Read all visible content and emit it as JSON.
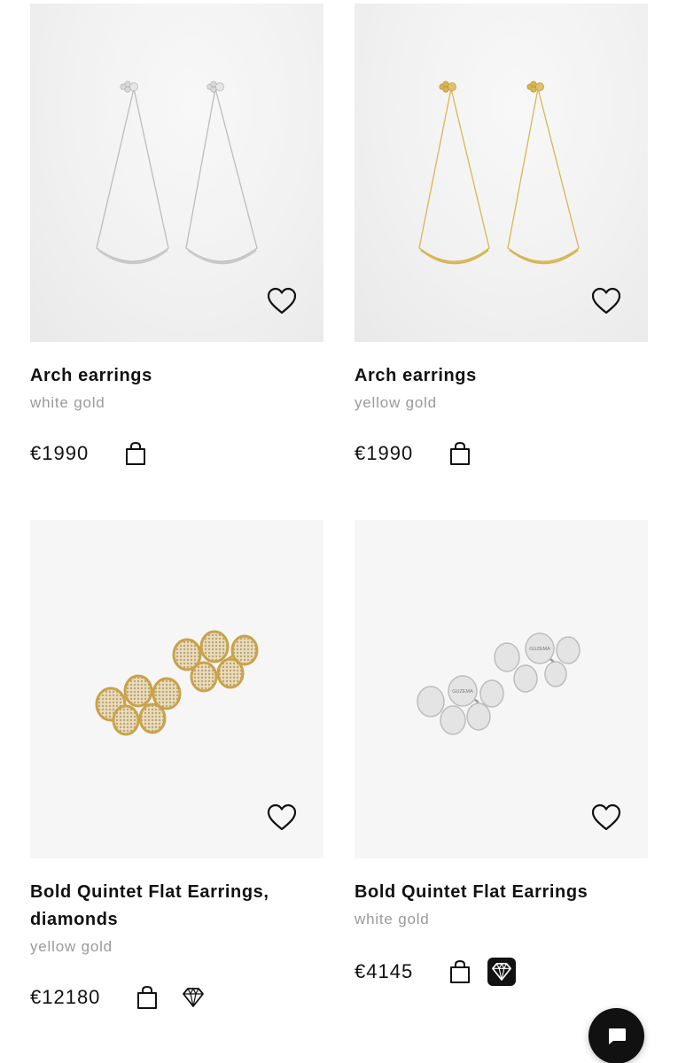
{
  "products": [
    {
      "title": "Arch earrings",
      "variant": "white gold",
      "price": "€1990",
      "icons": [
        "heart-icon",
        "shopping-bag-icon"
      ]
    },
    {
      "title": "Arch earrings",
      "variant": "yellow gold",
      "price": "€1990",
      "icons": [
        "heart-icon",
        "shopping-bag-icon"
      ]
    },
    {
      "title_line1": "Bold Quintet Flat Earrings,",
      "title_line2": "diamonds",
      "variant": "yellow gold",
      "price": "€12180",
      "icons": [
        "heart-icon",
        "shopping-bag-icon",
        "diamond-icon"
      ]
    },
    {
      "title": "Bold Quintet Flat Earrings",
      "variant": "white gold",
      "price": "€4145",
      "engraving": "GUZEMA",
      "icons": [
        "heart-icon",
        "shopping-bag-icon",
        "diamond-badge-icon"
      ]
    }
  ],
  "chat": {
    "icon": "chat-icon"
  },
  "colors": {
    "white_gold": "#c9c9c9",
    "yellow_gold": "#d8b656",
    "text": "#111111",
    "muted": "#9a9a9a"
  }
}
